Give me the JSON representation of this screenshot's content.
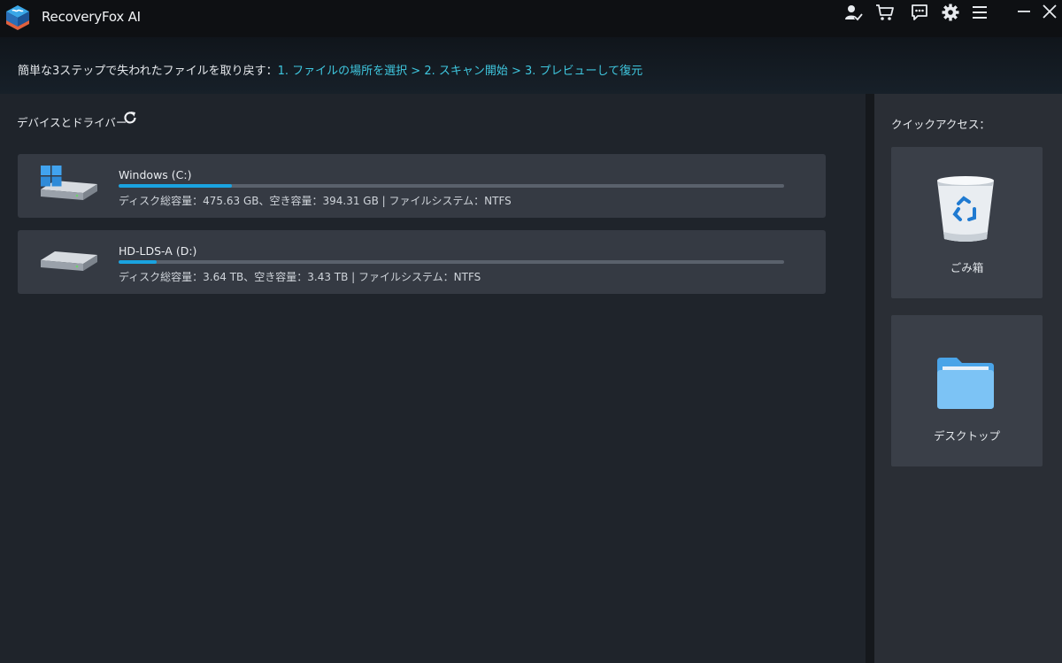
{
  "app": {
    "title": "RecoveryFox AI",
    "icons": [
      "app-logo",
      "user-check-icon",
      "cart-icon",
      "feedback-icon",
      "gear-icon",
      "menu-icon",
      "minimize-icon",
      "close-icon"
    ]
  },
  "banner": {
    "intro": "簡単な3ステップで失われたファイルを取り戻す：",
    "steps": "1. ファイルの場所を選択 > 2. スキャン開始 > 3. プレビューして復元"
  },
  "devices": {
    "title": "デバイスとドライバー",
    "refresh_icon": "refresh-icon",
    "drives": [
      {
        "name": "Windows (C:)",
        "info": "ディスク総容量：475.63 GB、空き容量：394.31 GB | ファイルシステム：NTFS",
        "used_fraction": 0.17,
        "icon": "windows-drive-icon"
      },
      {
        "name": "HD-LDS-A (D:)",
        "info": "ディスク総容量：3.64 TB、空き容量：3.43 TB | ファイルシステム：NTFS",
        "used_fraction": 0.057,
        "icon": "hard-drive-icon"
      }
    ]
  },
  "quick_access": {
    "title": "クイックアクセス：",
    "items": [
      {
        "label": "ごみ箱",
        "icon": "recycle-bin-icon"
      },
      {
        "label": "デスクトップ",
        "icon": "folder-icon"
      }
    ]
  },
  "colors": {
    "accent": "#3fc7df",
    "progress": "#1aa3e0",
    "card": "#353a43",
    "background": "#1f242b"
  }
}
